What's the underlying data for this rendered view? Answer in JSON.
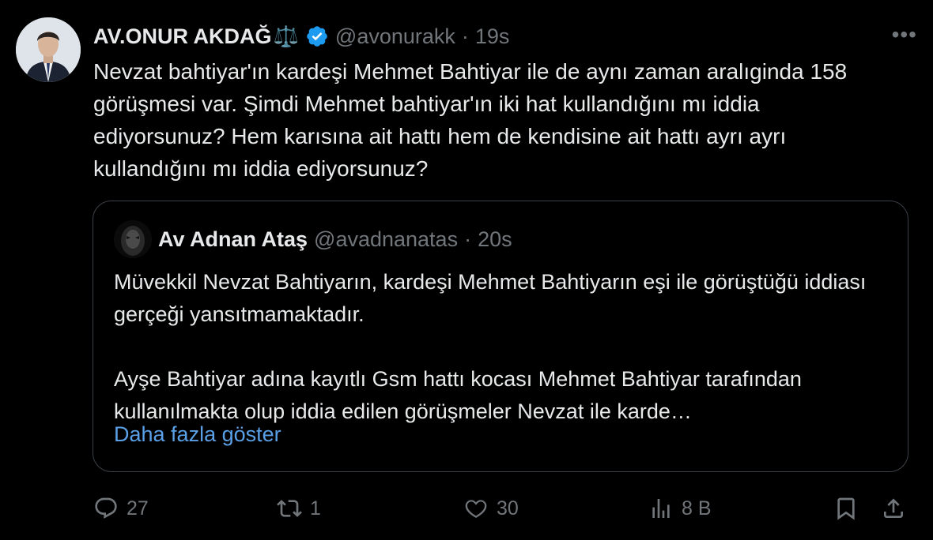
{
  "author": {
    "display_name": "AV.ONUR AKDAĞ",
    "badge_emoji": "⚖️",
    "handle": "@avonurakk",
    "separator": "·",
    "time": "19s"
  },
  "tweet": {
    "text": "Nevzat bahtiyar'ın kardeşi Mehmet Bahtiyar ile de aynı zaman aralıginda 158 görüşmesi var. Şimdi Mehmet bahtiyar'ın iki hat kullandığını mı iddia ediyorsunuz? Hem karısına ait hattı hem de kendisine ait hattı ayrı ayrı kullandığını mı iddia ediyorsunuz?"
  },
  "quoted": {
    "display_name": "Av Adnan Ataş",
    "handle": "@avadnanatas",
    "separator": "·",
    "time": "20s",
    "paragraph_1": "Müvekkil Nevzat Bahtiyarın, kardeşi Mehmet Bahtiyarın eşi ile görüştüğü iddiası gerçeği yansıtmamaktadır.",
    "paragraph_2": "Ayşe Bahtiyar adına kayıtlı Gsm hattı kocası Mehmet Bahtiyar tarafından kullanılmakta olup iddia edilen görüşmeler Nevzat ile karde…",
    "show_more": "Daha fazla göster"
  },
  "actions": {
    "replies": "27",
    "reposts": "1",
    "likes": "30",
    "views": "8 B"
  },
  "icons": [
    "more-icon",
    "verified-icon",
    "reply-icon",
    "repost-icon",
    "like-icon",
    "views-icon",
    "bookmark-icon",
    "share-icon"
  ],
  "colors": {
    "background": "#000000",
    "text": "#e7e9ea",
    "muted": "#71767b",
    "link": "#5aa0e6",
    "verified": "#1d9bf0",
    "border": "#3c4148"
  }
}
